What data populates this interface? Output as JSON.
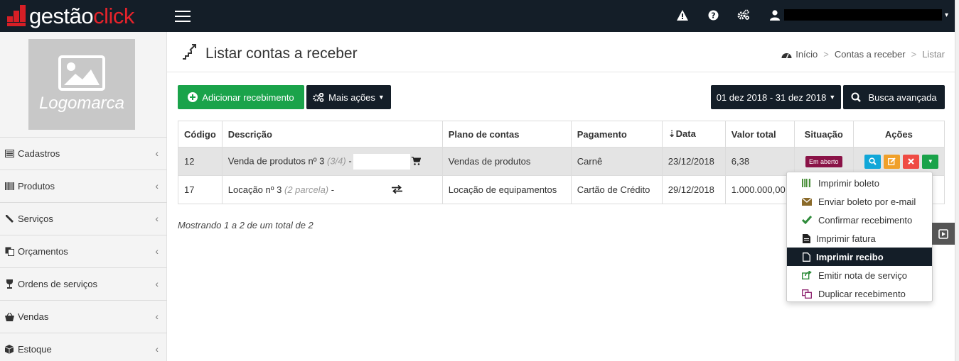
{
  "brand": {
    "part1": "gestão",
    "part2": "click",
    "accent": "#e5232b",
    "topbar_color": "#141e28"
  },
  "topbar": {
    "icons": [
      "warning-icon",
      "help-icon",
      "settings-icon",
      "user-icon"
    ]
  },
  "sidebar": {
    "logo_placeholder": "Logomarca",
    "items": [
      {
        "label": "Cadastros",
        "icon": "list-icon"
      },
      {
        "label": "Produtos",
        "icon": "barcode-icon"
      },
      {
        "label": "Serviços",
        "icon": "wrench-icon"
      },
      {
        "label": "Orçamentos",
        "icon": "copy-icon"
      },
      {
        "label": "Ordens de serviços",
        "icon": "wine-icon"
      },
      {
        "label": "Vendas",
        "icon": "basket-icon"
      },
      {
        "label": "Estoque",
        "icon": "cube-icon"
      }
    ]
  },
  "page": {
    "title": "Listar contas a receber",
    "breadcrumb": [
      "Início",
      "Contas a receber",
      "Listar"
    ]
  },
  "toolbar": {
    "add_label": "Adicionar recebimento",
    "more_label": "Mais ações",
    "date_range": "01 dez 2018 - 31 dez 2018",
    "advanced_search": "Busca avançada"
  },
  "table": {
    "headers": [
      "Código",
      "Descrição",
      "Plano de contas",
      "Pagamento",
      "Data",
      "Valor total",
      "Situação",
      "Ações"
    ],
    "rows": [
      {
        "code": "12",
        "desc": "Venda de produtos nº 3",
        "desc_note": "(3/4)",
        "desc_suffix": "-",
        "plan": "Vendas de produtos",
        "payment": "Carnê",
        "date": "23/12/2018",
        "total": "6,38",
        "status": "Em aberto"
      },
      {
        "code": "17",
        "desc": "Locação nº 3",
        "desc_note": "(2 parcela)",
        "desc_suffix": "-",
        "plan": "Locação de equipamentos",
        "payment": "Cartão de Crédito",
        "date": "29/12/2018",
        "total": "1.000.000,00",
        "status": ""
      }
    ],
    "footer": "Mostrando 1 a 2 de um total de 2"
  },
  "dropdown": {
    "items": [
      {
        "label": "Imprimir boleto",
        "icon": "barcode-icon"
      },
      {
        "label": "Enviar boleto por e-mail",
        "icon": "envelope-icon"
      },
      {
        "label": "Confirmar recebimento",
        "icon": "check-icon"
      },
      {
        "label": "Imprimir fatura",
        "icon": "file-icon"
      },
      {
        "label": "Imprimir recibo",
        "icon": "file-outline-icon"
      },
      {
        "label": "Emitir nota de serviço",
        "icon": "share-icon"
      },
      {
        "label": "Duplicar recebimento",
        "icon": "duplicate-icon"
      }
    ],
    "active_index": 4
  }
}
